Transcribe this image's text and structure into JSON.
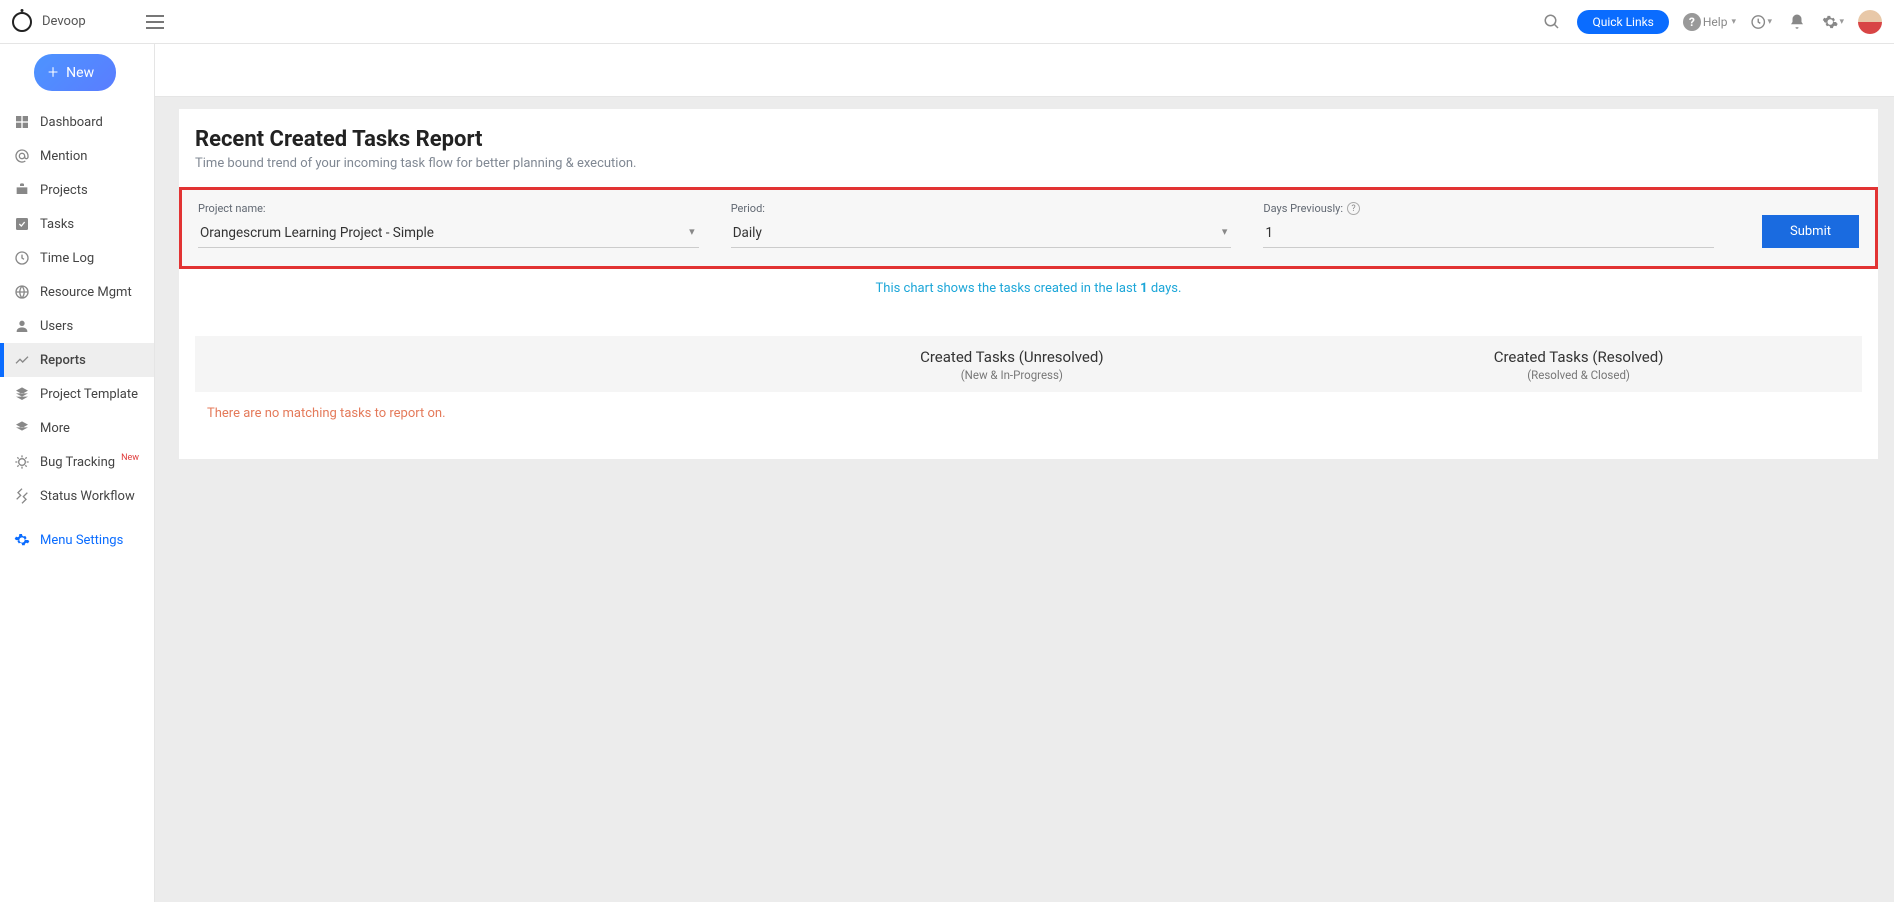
{
  "header": {
    "brand": "Devoop",
    "quick_links": "Quick Links",
    "help": "Help"
  },
  "sidebar": {
    "new_btn": "New",
    "items": [
      {
        "label": "Dashboard"
      },
      {
        "label": "Mention"
      },
      {
        "label": "Projects"
      },
      {
        "label": "Tasks"
      },
      {
        "label": "Time Log"
      },
      {
        "label": "Resource Mgmt"
      },
      {
        "label": "Users"
      },
      {
        "label": "Reports"
      },
      {
        "label": "Project Template"
      },
      {
        "label": "More"
      },
      {
        "label": "Bug Tracking",
        "badge": "New"
      },
      {
        "label": "Status Workflow"
      }
    ],
    "menu_settings": "Menu Settings"
  },
  "page": {
    "title": "Recent Created Tasks Report",
    "subtitle": "Time bound trend of your incoming task flow for better planning & execution.",
    "filters": {
      "project_label": "Project name:",
      "project_value": "Orangescrum Learning Project - Simple",
      "period_label": "Period:",
      "period_value": "Daily",
      "days_label": "Days Previously:",
      "days_value": "1",
      "submit": "Submit"
    },
    "chart_note_prefix": "This chart shows the tasks created in the last ",
    "chart_note_days": "1",
    "chart_note_suffix": " days.",
    "table": {
      "col1_title": "Created Tasks (Unresolved)",
      "col1_sub": "(New & In-Progress)",
      "col2_title": "Created Tasks (Resolved)",
      "col2_sub": "(Resolved & Closed)"
    },
    "no_data": "There are no matching tasks to report on."
  }
}
